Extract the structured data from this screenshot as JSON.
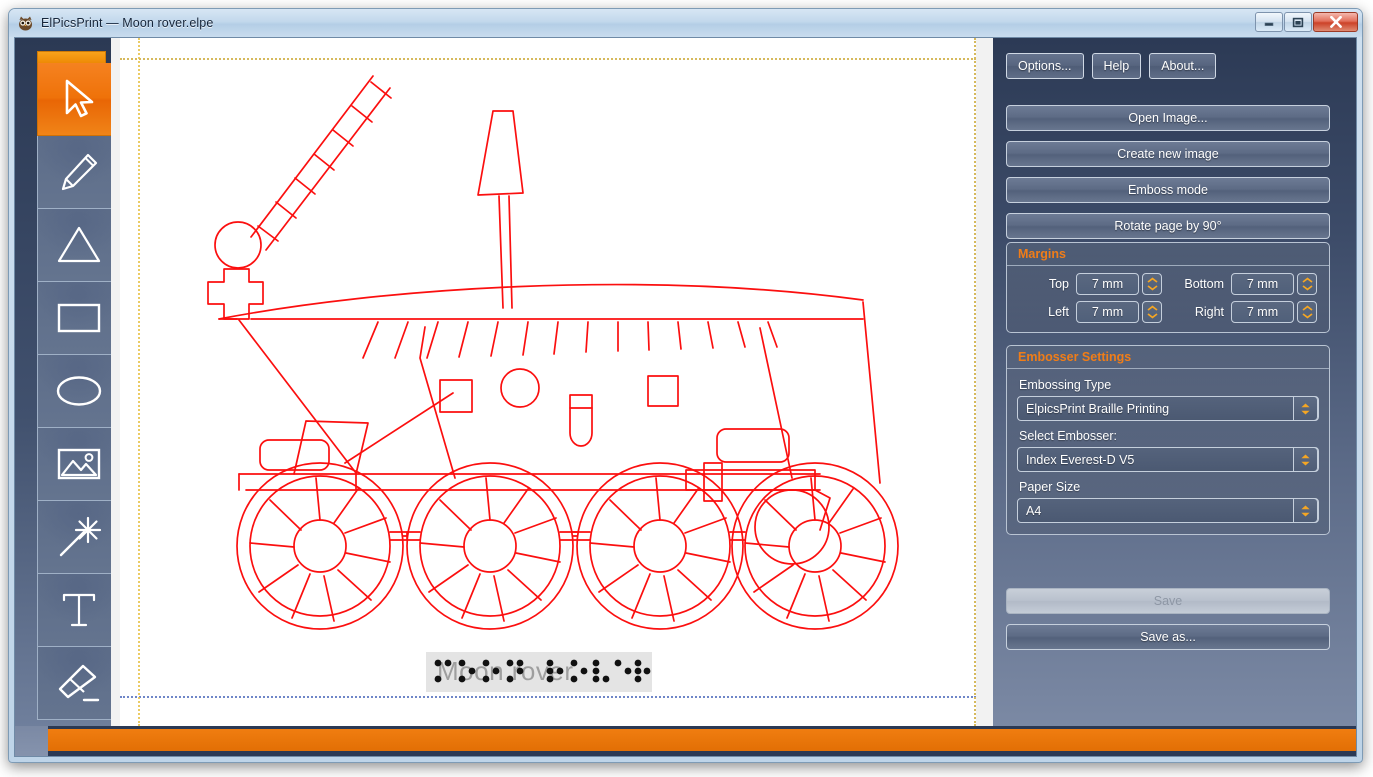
{
  "window": {
    "title": "ElPicsPrint — Moon rover.elpe",
    "app_icon": "owl-icon",
    "minimize_label": "Minimize",
    "maximize_label": "Maximize",
    "close_label": "Close"
  },
  "toolbar": {
    "tools": [
      {
        "name": "select-tool",
        "icon": "cursor-arrow-icon",
        "active": true
      },
      {
        "name": "pencil-tool",
        "icon": "pencil-icon",
        "active": false
      },
      {
        "name": "triangle-tool",
        "icon": "triangle-icon",
        "active": false
      },
      {
        "name": "rectangle-tool",
        "icon": "rectangle-icon",
        "active": false
      },
      {
        "name": "ellipse-tool",
        "icon": "ellipse-icon",
        "active": false
      },
      {
        "name": "image-tool",
        "icon": "picture-icon",
        "active": false
      },
      {
        "name": "magic-wand-tool",
        "icon": "magic-wand-icon",
        "active": false
      },
      {
        "name": "text-tool",
        "icon": "text-t-icon",
        "active": false
      },
      {
        "name": "eraser-tool",
        "icon": "eraser-icon",
        "active": false
      }
    ]
  },
  "canvas": {
    "drawing_title": "Moon rover line drawing",
    "drawing_color": "#fb0f0f",
    "page_color": "#ffffff",
    "guide_color": "#6f86c8",
    "text_object": {
      "label": "Moon rover",
      "braille": "⠍⠕⠕⠝ ⠗⠕⠧⠑⠗",
      "text_color": "#9e9e9e",
      "dot_color": "#111111",
      "box_color": "#e4e4e4"
    }
  },
  "panel": {
    "top_buttons": [
      {
        "name": "options-button",
        "label": "Options..."
      },
      {
        "name": "help-button",
        "label": "Help"
      },
      {
        "name": "about-button",
        "label": "About..."
      }
    ],
    "actions": [
      {
        "name": "open-image-button",
        "label": "Open Image..."
      },
      {
        "name": "create-new-image-button",
        "label": "Create new image"
      },
      {
        "name": "emboss-mode-button",
        "label": "Emboss mode"
      },
      {
        "name": "rotate-page-button",
        "label": "Rotate page by 90°"
      }
    ],
    "margins": {
      "title": "Margins",
      "accent_color": "#f07d18",
      "fields": [
        {
          "name": "margin-top",
          "label": "Top",
          "value": "7 mm"
        },
        {
          "name": "margin-bottom",
          "label": "Bottom",
          "value": "7 mm"
        },
        {
          "name": "margin-left",
          "label": "Left",
          "value": "7 mm"
        },
        {
          "name": "margin-right",
          "label": "Right",
          "value": "7 mm"
        }
      ]
    },
    "embosser": {
      "title": "Embosser Settings",
      "fields": [
        {
          "name": "embossing-type",
          "label": "Embossing Type",
          "value": "ElpicsPrint Braille Printing"
        },
        {
          "name": "select-embosser",
          "label": "Select Embosser:",
          "value": "Index Everest-D V5"
        },
        {
          "name": "paper-size",
          "label": "Paper Size",
          "value": "A4"
        }
      ]
    },
    "save": {
      "name": "save-button",
      "label": "Save",
      "enabled": false
    },
    "save_as": {
      "name": "save-as-button",
      "label": "Save as...",
      "enabled": true
    }
  },
  "statusbar": {
    "progress_color": "#e8760a"
  }
}
